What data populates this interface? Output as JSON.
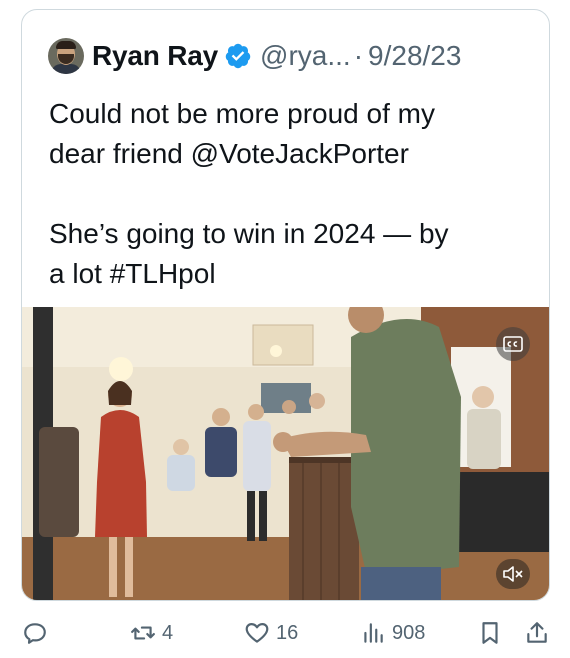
{
  "tweet": {
    "author_name": "Ryan Ray",
    "handle": "@rya...",
    "separator": "·",
    "date": "9/28/23",
    "text_lines": [
      "Could not be more proud of my",
      "dear friend @VoteJackPorter",
      "She’s going to win in 2024 — by",
      "a lot #TLHpol"
    ]
  },
  "media": {
    "type": "video",
    "captions_icon": "closed-captions-icon",
    "mute_icon": "muted-speaker-icon"
  },
  "actions": {
    "reply": {
      "icon": "reply-icon",
      "count": ""
    },
    "repost": {
      "icon": "repost-icon",
      "count": "4"
    },
    "like": {
      "icon": "heart-icon",
      "count": "16"
    },
    "views": {
      "icon": "views-chart-icon",
      "count": "908"
    },
    "bookmark": {
      "icon": "bookmark-icon"
    },
    "share": {
      "icon": "share-icon"
    }
  },
  "colors": {
    "text": "#0f1419",
    "secondary": "#536471",
    "verified": "#1d9bf0",
    "border": "#cfd9de"
  }
}
